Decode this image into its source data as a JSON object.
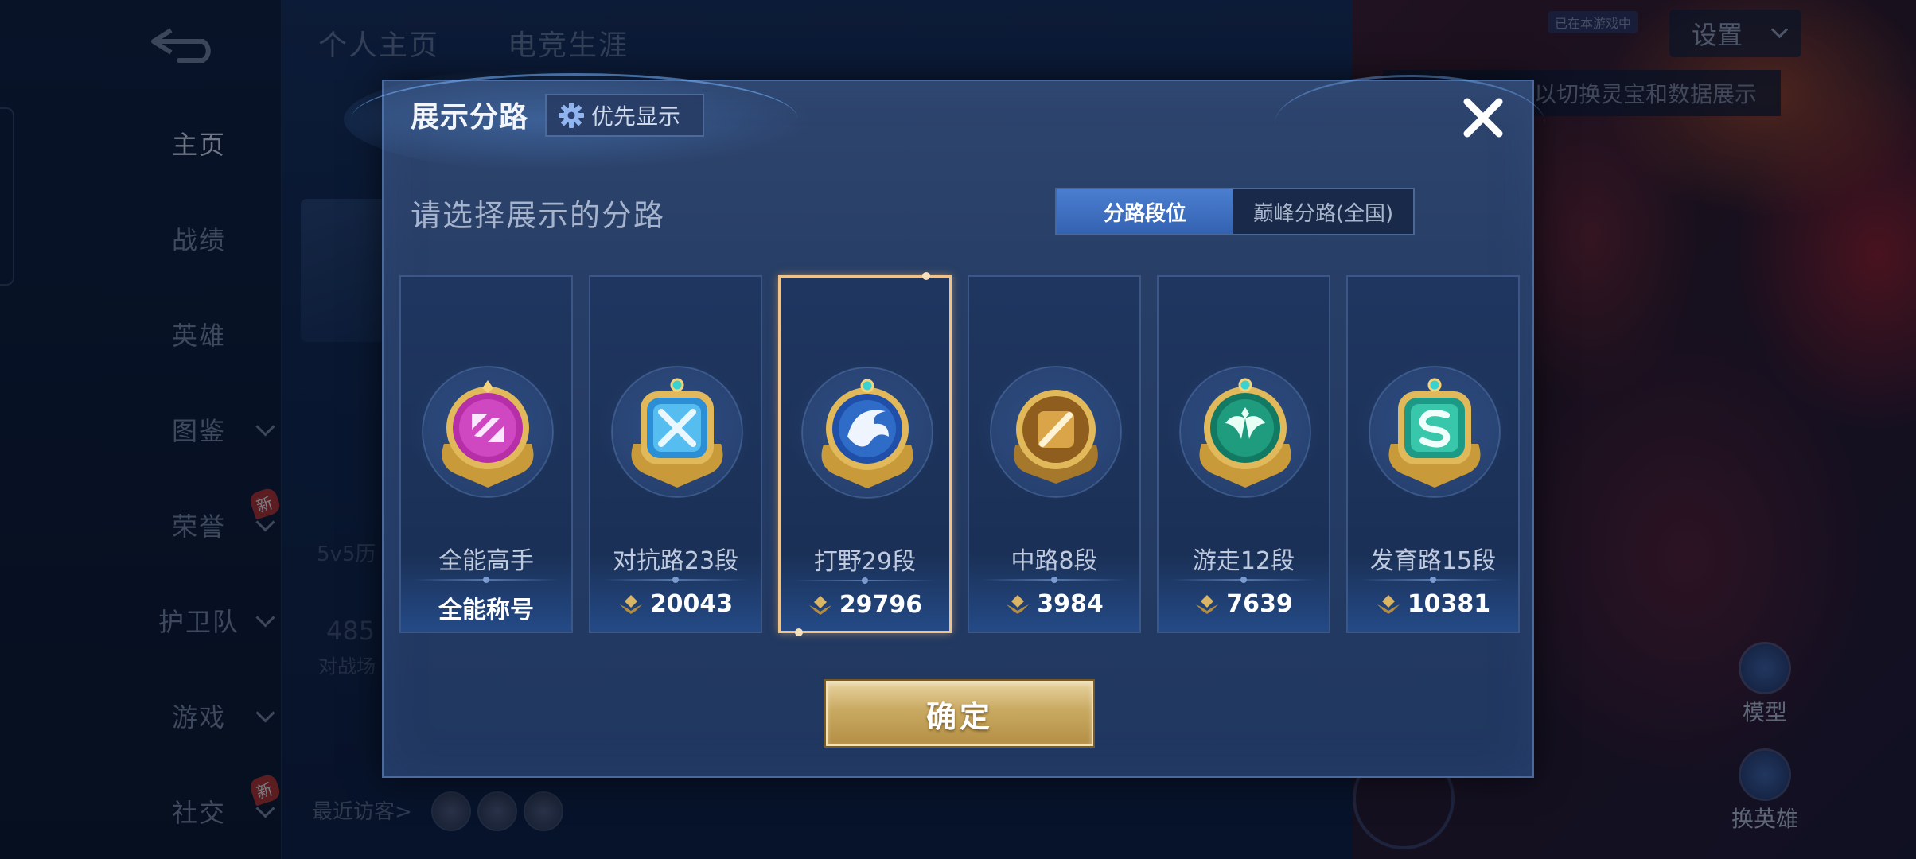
{
  "background": {
    "top_tabs": [
      "个人主页",
      "电竞生涯"
    ],
    "nav": [
      {
        "label": "主页",
        "active": true,
        "chevron": false,
        "badge": ""
      },
      {
        "label": "战绩",
        "active": false,
        "chevron": false,
        "badge": ""
      },
      {
        "label": "英雄",
        "active": false,
        "chevron": false,
        "badge": ""
      },
      {
        "label": "图鉴",
        "active": false,
        "chevron": true,
        "badge": ""
      },
      {
        "label": "荣誉",
        "active": false,
        "chevron": true,
        "badge": "新"
      },
      {
        "label": "护卫队",
        "active": false,
        "chevron": true,
        "badge": ""
      },
      {
        "label": "游戏",
        "active": false,
        "chevron": true,
        "badge": ""
      },
      {
        "label": "社交",
        "active": false,
        "chevron": true,
        "badge": "新"
      }
    ],
    "settings_label": "设置",
    "small_tag": "已在本游戏中",
    "hint_text": "以切换灵宝和数据展示",
    "model_label": "模型",
    "switch_hero_label": "换英雄",
    "recent_visitors_label": "最近访客>",
    "faint_text_1": "5v5历",
    "faint_text_2": "485",
    "faint_text_3": "对战场"
  },
  "dialog": {
    "title": "展示分路",
    "priority_label": "优先显示",
    "prompt": "请选择展示的分路",
    "toggle": [
      {
        "label": "分路段位",
        "active": true
      },
      {
        "label": "巅峰分路(全国)",
        "active": false
      }
    ],
    "cards": [
      {
        "name": "全能高手",
        "score": "全能称号",
        "has_score_icon": false,
        "selected": false,
        "emblem": "all-round-emblem",
        "color": "#c03ab8"
      },
      {
        "name": "对抗路23段",
        "score": "20043",
        "has_score_icon": true,
        "selected": false,
        "emblem": "clash-lane-emblem",
        "color": "#3aa4e0"
      },
      {
        "name": "打野29段",
        "score": "29796",
        "has_score_icon": true,
        "selected": true,
        "emblem": "jungle-emblem",
        "color": "#2f6cc8"
      },
      {
        "name": "中路8段",
        "score": "3984",
        "has_score_icon": true,
        "selected": false,
        "emblem": "mid-lane-emblem",
        "color": "#b9802c"
      },
      {
        "name": "游走12段",
        "score": "7639",
        "has_score_icon": true,
        "selected": false,
        "emblem": "roam-emblem",
        "color": "#1f9c7e"
      },
      {
        "name": "发育路15段",
        "score": "10381",
        "has_score_icon": true,
        "selected": false,
        "emblem": "farm-lane-emblem",
        "color": "#2fb8a0"
      }
    ],
    "confirm_label": "确定"
  }
}
